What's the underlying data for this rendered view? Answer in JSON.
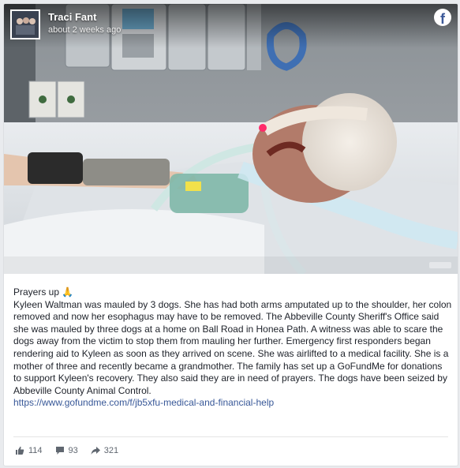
{
  "header": {
    "author": "Traci Fant",
    "timestamp": "about 2 weeks ago",
    "logo": "facebook-logo"
  },
  "post": {
    "line1": "Prayers up 🙏",
    "body": "Kyleen Waltman was mauled by 3 dogs. She has had both arms amputated up to the shoulder, her colon removed and now her esophagus may have to be removed. The Abbeville County Sheriff's Office said she was mauled by three dogs at a home on Ball Road in Honea Path. A witness was able to scare the dogs away from the victim to stop them from mauling her further. Emergency first responders began rendering aid to Kyleen as soon as they arrived on scene. She was airlifted to a medical facility. She is a mother of three and recently became a grandmother. The family has set up a GoFundMe for donations to support Kyleen's recovery. They also said they are in need of prayers. The dogs have been seized by Abbeville County Animal Control.",
    "link": "https://www.gofundme.com/f/jb5xfu-medical-and-financial-help"
  },
  "stats": {
    "likes": "114",
    "comments": "93",
    "shares": "321"
  },
  "colors": {
    "link": "#385898",
    "facebook": "#3b5998"
  }
}
